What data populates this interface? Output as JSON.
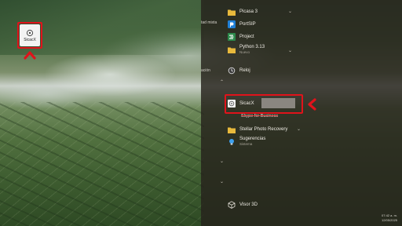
{
  "desktop": {
    "shortcut_label": "SicacX"
  },
  "left_cut_labels": {
    "label_1": "tad mixta",
    "label_2": "ación"
  },
  "start_menu": {
    "apps": [
      {
        "name": "Picasa 3",
        "sub": "",
        "icon": "folder-icon"
      },
      {
        "name": "PortSIP",
        "sub": "",
        "icon": "portsip-icon"
      },
      {
        "name": "Project",
        "sub": "",
        "icon": "project-icon"
      },
      {
        "name": "Python 3.13",
        "sub": "Nuevo",
        "icon": "folder-icon"
      },
      {
        "name": "Reloj",
        "sub": "",
        "icon": "clock-icon"
      },
      {
        "name": "SicacX",
        "sub": "",
        "icon": "sicacx-icon"
      },
      {
        "name": "Skype for Business",
        "sub": "",
        "icon": "skype-icon"
      },
      {
        "name": "Stellar Photo Recovery",
        "sub": "",
        "icon": "folder-icon"
      },
      {
        "name": "Sugerencias",
        "sub": "Sistema",
        "icon": "lightbulb-icon"
      },
      {
        "name": "Visor 3D",
        "sub": "",
        "icon": "cube-icon"
      }
    ]
  },
  "taskbar": {
    "time": "07:42 a. m.",
    "date": "12/05/2025"
  },
  "colors": {
    "highlight": "#e0131b",
    "folder": "#e8b93c",
    "panel": "#26221c"
  }
}
